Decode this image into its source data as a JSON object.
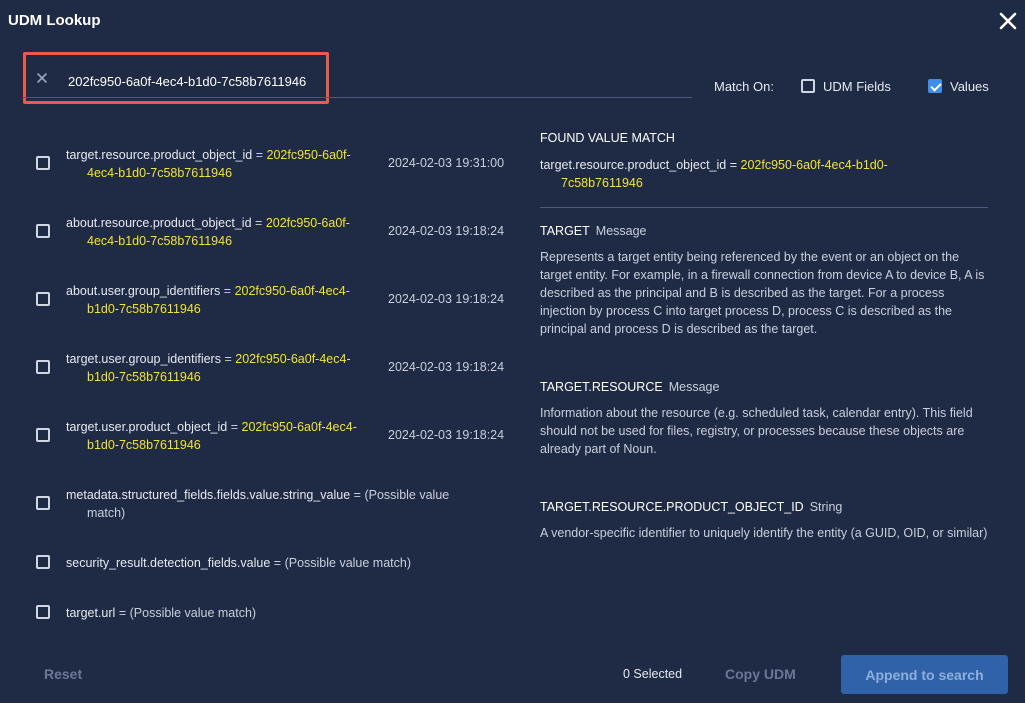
{
  "header": {
    "title": "UDM Lookup"
  },
  "search": {
    "value": "202fc950-6a0f-4ec4-b1d0-7c58b7611946"
  },
  "match_on": {
    "label": "Match On:",
    "udm_fields": {
      "label": "UDM Fields",
      "checked": false
    },
    "values": {
      "label": "Values",
      "checked": true
    }
  },
  "results": [
    {
      "field": "target.resource.product_object_id",
      "value": "202fc950-6a0f-4ec4-b1d0-7c58b7611946",
      "time": "2024-02-03 19:31:00"
    },
    {
      "field": "about.resource.product_object_id",
      "value": "202fc950-6a0f-4ec4-b1d0-7c58b7611946",
      "time": "2024-02-03 19:18:24"
    },
    {
      "field": "about.user.group_identifiers",
      "value": "202fc950-6a0f-4ec4-b1d0-7c58b7611946",
      "time": "2024-02-03 19:18:24"
    },
    {
      "field": "target.user.group_identifiers",
      "value": "202fc950-6a0f-4ec4-b1d0-7c58b7611946",
      "time": "2024-02-03 19:18:24"
    },
    {
      "field": "target.user.product_object_id",
      "value": "202fc950-6a0f-4ec4-b1d0-7c58b7611946",
      "time": "2024-02-03 19:18:24"
    },
    {
      "field": "metadata.structured_fields.fields.value.string_value",
      "possible": "(Possible value match)"
    },
    {
      "field": "security_result.detection_fields.value",
      "possible": "(Possible value match)"
    },
    {
      "field": "target.url",
      "possible": "(Possible value match)"
    }
  ],
  "eq": "=",
  "detail": {
    "found_header": "FOUND VALUE MATCH",
    "found_field": "target.resource.product_object_id",
    "found_value": "202fc950-6a0f-4ec4-b1d0-7c58b7611946",
    "sections": [
      {
        "name": "TARGET",
        "type": "Message",
        "desc": "Represents a target entity being referenced by the event or an object on the target entity. For example, in a firewall connection from device A to device B, A is described as the principal and B is described as the target. For a process injection by process C into target process D, process C is described as the principal and process D is described as the target."
      },
      {
        "name": "TARGET.RESOURCE",
        "type": "Message",
        "desc": "Information about the resource (e.g. scheduled task, calendar entry). This field should not be used for files, registry, or processes because these objects are already part of Noun."
      },
      {
        "name": "TARGET.RESOURCE.PRODUCT_OBJECT_ID",
        "type": "String",
        "desc": "A vendor-specific identifier to uniquely identify the entity (a GUID, OID, or similar)"
      }
    ]
  },
  "footer": {
    "reset": "Reset",
    "selected": "0 Selected",
    "copy": "Copy UDM",
    "append": "Append to search"
  }
}
